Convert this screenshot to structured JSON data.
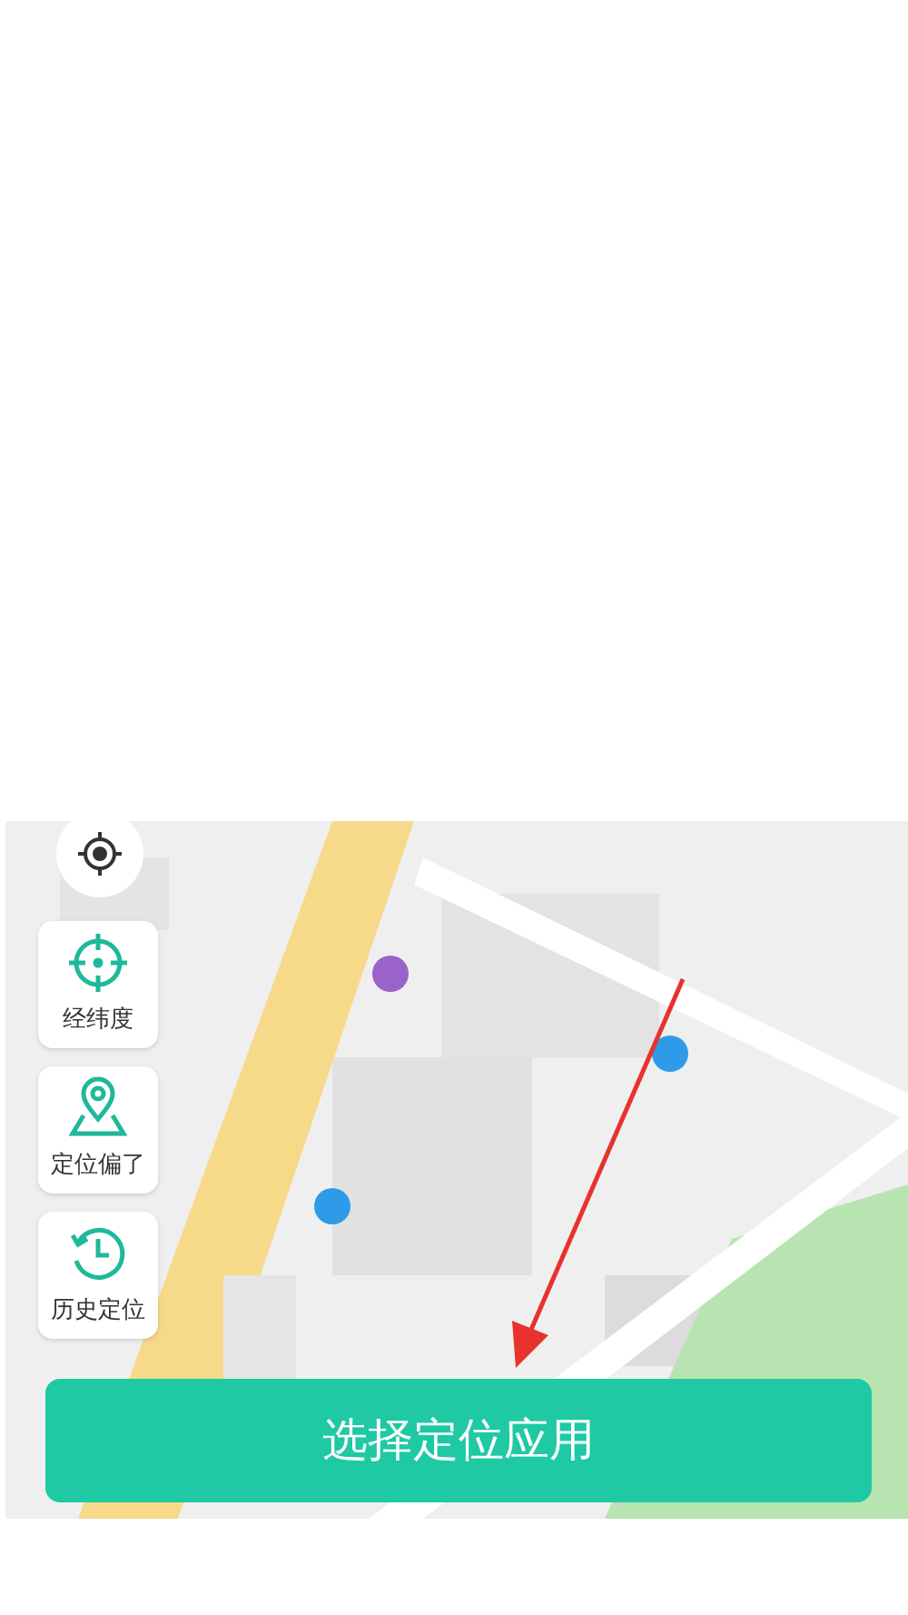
{
  "tools": [
    {
      "kind": "coordinates",
      "label": "经纬度"
    },
    {
      "kind": "offset",
      "label": "定位偏了"
    },
    {
      "kind": "history",
      "label": "历史定位"
    }
  ],
  "primary_button": {
    "label": "选择定位应用"
  }
}
